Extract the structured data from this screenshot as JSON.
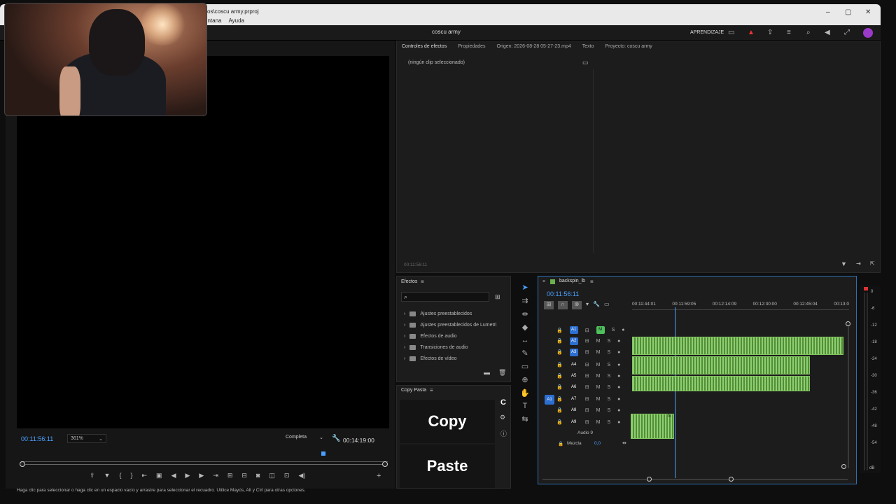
{
  "window": {
    "title": "vos\\coscu army.prproj",
    "menu": [
      "entana",
      "Ayuda"
    ],
    "controls": [
      "–",
      "▢",
      "✕"
    ]
  },
  "app": {
    "project_title": "coscu army",
    "learn_label": "APRENDIZAJE"
  },
  "program_monitor": {
    "timecode": "00:11:56:11",
    "zoom": "361%",
    "quality": "Completa",
    "duration": "00:14:19:00"
  },
  "effect_controls": {
    "tabs": [
      "Controles de efectos",
      "Propiedades",
      "Origen: 2026-08-28 05-27-23.mp4",
      "Texto",
      "Proyecto: coscu army"
    ],
    "no_clip": "(ningún clip seleccionado)",
    "timecode": "00:11:56:11"
  },
  "effects_panel": {
    "title": "Efectos",
    "items": [
      "Ajustes preestablecidos",
      "Ajustes preestablecidos de Lumetri",
      "Efectos de audio",
      "Transiciones de audio",
      "Efectos de vídeo"
    ]
  },
  "copy_paste": {
    "title": "Copy Pasta",
    "copy_label": "Copy",
    "paste_label": "Paste",
    "c_label": "C"
  },
  "timeline": {
    "sequence_name": "backspin_lb",
    "timecode": "00:11:56:11",
    "ruler": [
      "00:11:44:01",
      "00:11:59:05",
      "00:12:14:09",
      "00:12:30:00",
      "00:12:45:04",
      "00:13:0"
    ],
    "tracks": [
      {
        "id": "A1",
        "m": "M",
        "s": "S"
      },
      {
        "id": "A2",
        "m": "M",
        "s": "S"
      },
      {
        "id": "A3",
        "m": "M",
        "s": "S"
      },
      {
        "id": "A4",
        "m": "M",
        "s": "S"
      },
      {
        "id": "A5",
        "m": "M",
        "s": "S"
      },
      {
        "id": "A6",
        "m": "M",
        "s": "S"
      },
      {
        "id": "A7",
        "m": "M",
        "s": "S"
      },
      {
        "id": "A8",
        "m": "M",
        "s": "S"
      },
      {
        "id": "A9",
        "m": "M",
        "s": "S"
      }
    ],
    "source_patch": "A1",
    "audio9_label": "Audio 9",
    "mix_label": "Mezcla",
    "mix_value": "0,0",
    "clip_fx": "fx"
  },
  "meters": {
    "scale": [
      "0",
      "-6",
      "-12",
      "-18",
      "-24",
      "-30",
      "-36",
      "-42",
      "-48",
      "-54",
      "dB"
    ]
  },
  "status": "Haga clic para seleccionar o haga clic en un espacio vacío y arrastre para seleccionar el recuadro. Utilice Mayús, Alt y Ctrl para otras opciones."
}
